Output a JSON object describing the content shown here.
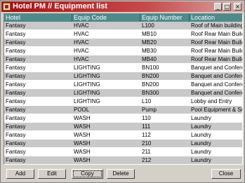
{
  "window": {
    "title": "Hotel PM // Equipment list"
  },
  "titlebar_buttons": [
    "_",
    "□",
    "×"
  ],
  "grid": {
    "columns": [
      "Hotel",
      "Equip Code",
      "Equip Number",
      "Location"
    ],
    "rows": [
      [
        "Fantasy",
        "HVAC",
        "L100",
        "Roof of Main building"
      ],
      [
        "Fantasy",
        "HVAC",
        "MB10",
        "Roof Rear Main Buildin"
      ],
      [
        "Fantasy",
        "HVAC",
        "MB20",
        "Roof Rear Main Buildin"
      ],
      [
        "Fantasy",
        "HVAC",
        "MB30",
        "Roof Rear Main Buildin"
      ],
      [
        "Fantasy",
        "HVAC",
        "MB40",
        "Roof Rear Main Buildin"
      ],
      [
        "Fantasy",
        "LIGHTING",
        "BN100",
        "Banquet and Conferen"
      ],
      [
        "Fantasy",
        "LIGHTING",
        "BN200",
        "Banquet and Conferen"
      ],
      [
        "Fantasy",
        "LIGHTING",
        "BN200",
        "Banquet and Conferen"
      ],
      [
        "Fantasy",
        "LIGHTING",
        "BN300",
        "Banquet and Conferen"
      ],
      [
        "Fantasy",
        "LIGHTING",
        "L10",
        "Lobby and Entry"
      ],
      [
        "Fantasy",
        "POOL",
        "Pump",
        "Pool Equipment & Supp"
      ],
      [
        "Fantasy",
        "WASH",
        "110",
        "Laundry"
      ],
      [
        "Fantasy",
        "WASH",
        "111",
        "Laundry"
      ],
      [
        "Fantasy",
        "WASH",
        "112",
        "Laundry"
      ],
      [
        "Fantasy",
        "WASH",
        "210",
        "Laundry"
      ],
      [
        "Fantasy",
        "WASH",
        "211",
        "Laundry"
      ],
      [
        "Fantasy",
        "WASH",
        "212",
        "Laundry"
      ]
    ]
  },
  "buttons": {
    "add": "Add",
    "edit": "Edit",
    "copy": "Copy",
    "delete": "Delete",
    "close": "Close"
  }
}
